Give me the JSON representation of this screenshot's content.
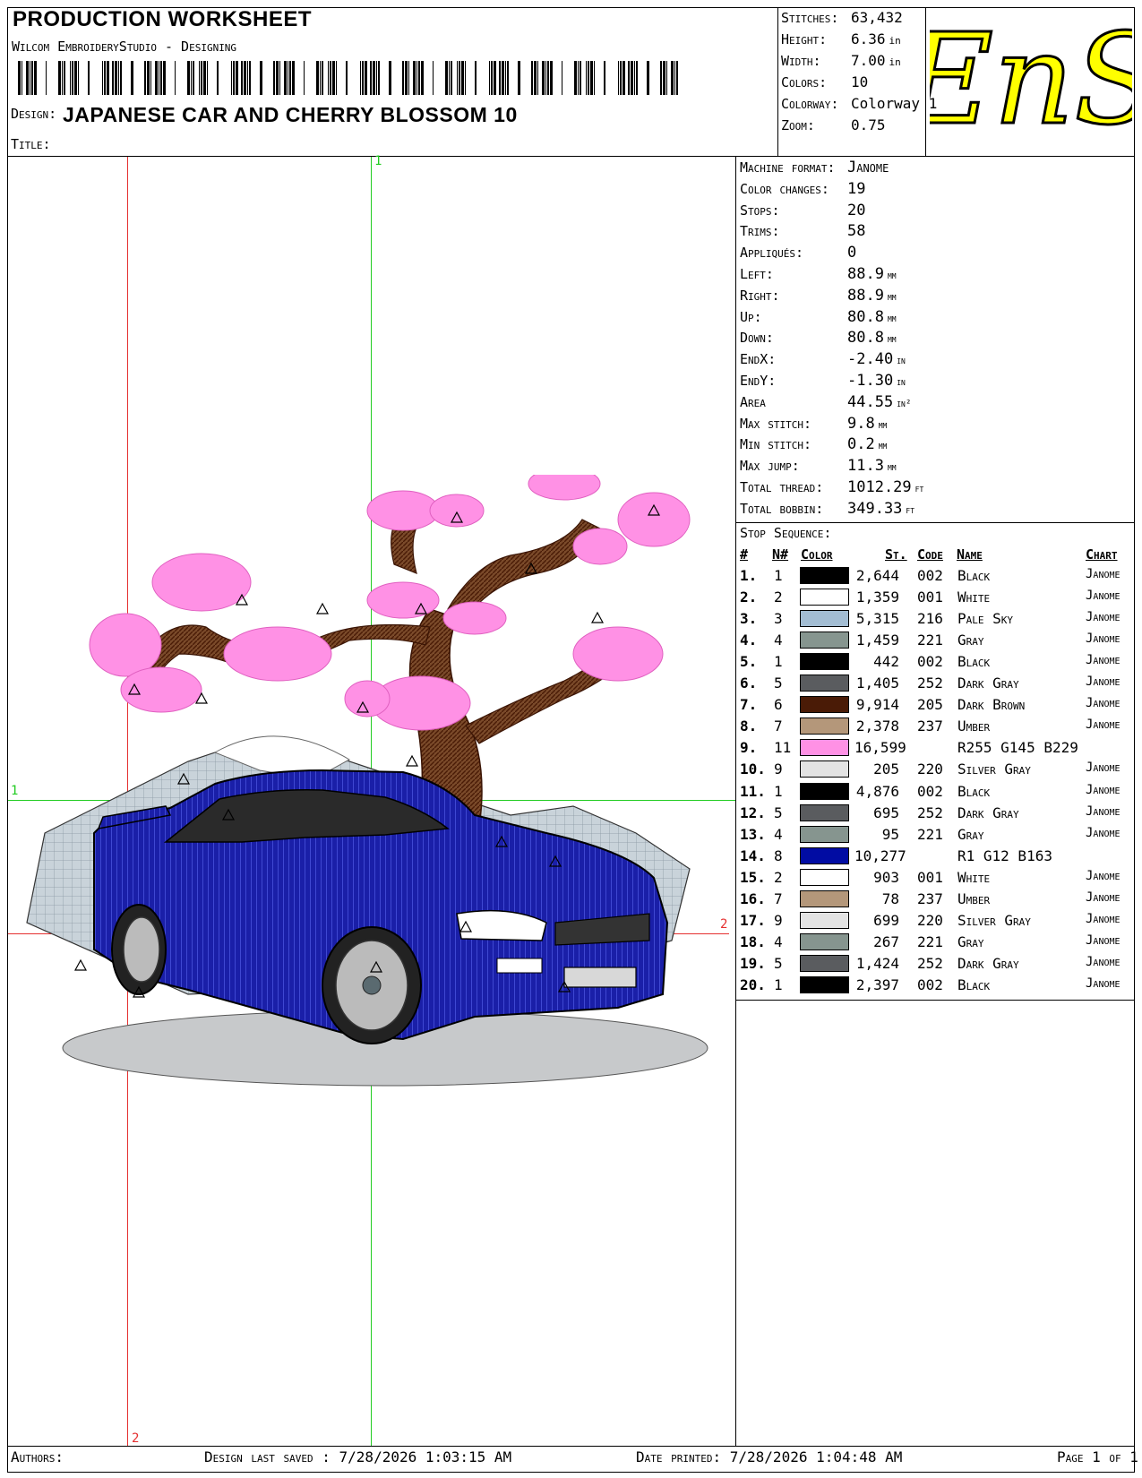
{
  "header": {
    "title": "PRODUCTION WORKSHEET",
    "subtitle": "Wilcom EmbroideryStudio - Designing",
    "design_label": "Design:",
    "design_name": "JAPANESE CAR AND CHERRY BLOSSOM  10",
    "title_label": "Title:"
  },
  "stats": [
    {
      "label": "Stitches:",
      "value": "63,432",
      "unit": ""
    },
    {
      "label": "Height:",
      "value": "6.36",
      "unit": "in"
    },
    {
      "label": "Width:",
      "value": "7.00",
      "unit": "in"
    },
    {
      "label": "Colors:",
      "value": "10",
      "unit": ""
    },
    {
      "label": "Colorway:",
      "value": "Colorway 1",
      "unit": ""
    },
    {
      "label": "Zoom:",
      "value": "0.75",
      "unit": ""
    }
  ],
  "logo": {
    "text": "EnS",
    "color": "#ffff00"
  },
  "info": [
    {
      "label": "Machine format:",
      "value": "Janome",
      "unit": ""
    },
    {
      "label": "Color changes:",
      "value": "19",
      "unit": ""
    },
    {
      "label": "Stops:",
      "value": "20",
      "unit": ""
    },
    {
      "label": "Trims:",
      "value": "58",
      "unit": ""
    },
    {
      "label": "Appliqués:",
      "value": "0",
      "unit": ""
    },
    {
      "label": "Left:",
      "value": "88.9",
      "unit": "mm"
    },
    {
      "label": "Right:",
      "value": "88.9",
      "unit": "mm"
    },
    {
      "label": "Up:",
      "value": "80.8",
      "unit": "mm"
    },
    {
      "label": "Down:",
      "value": "80.8",
      "unit": "mm"
    },
    {
      "label": "EndX:",
      "value": "-2.40",
      "unit": "in"
    },
    {
      "label": "EndY:",
      "value": "-1.30",
      "unit": "in"
    },
    {
      "label": "Area",
      "value": "44.55",
      "unit": "in²"
    },
    {
      "label": "Max stitch:",
      "value": "9.8",
      "unit": "mm"
    },
    {
      "label": "Min stitch:",
      "value": "0.2",
      "unit": "mm"
    },
    {
      "label": "Max jump:",
      "value": "11.3",
      "unit": "mm"
    },
    {
      "label": "Total thread:",
      "value": "1012.29",
      "unit": "ft"
    },
    {
      "label": "Total bobbin:",
      "value": "349.33",
      "unit": "ft"
    }
  ],
  "sequence": {
    "title": "Stop Sequence:",
    "headers": {
      "idx": "#",
      "n": "N#",
      "color": "Color",
      "st": "St.",
      "code": "Code",
      "name": "Name",
      "chart": "Chart"
    },
    "rows": [
      {
        "idx": "1.",
        "n": "1",
        "color": "#000000",
        "st": "2,644",
        "code": "002",
        "name": "Black",
        "chart": "Janome"
      },
      {
        "idx": "2.",
        "n": "2",
        "color": "#ffffff",
        "st": "1,359",
        "code": "001",
        "name": "White",
        "chart": "Janome"
      },
      {
        "idx": "3.",
        "n": "3",
        "color": "#a3bdd3",
        "st": "5,315",
        "code": "216",
        "name": "Pale Sky",
        "chart": "Janome"
      },
      {
        "idx": "4.",
        "n": "4",
        "color": "#86958f",
        "st": "1,459",
        "code": "221",
        "name": "Gray",
        "chart": "Janome"
      },
      {
        "idx": "5.",
        "n": "1",
        "color": "#000000",
        "st": "442",
        "code": "002",
        "name": "Black",
        "chart": "Janome"
      },
      {
        "idx": "6.",
        "n": "5",
        "color": "#5a5c5f",
        "st": "1,405",
        "code": "252",
        "name": "Dark Gray",
        "chart": "Janome"
      },
      {
        "idx": "7.",
        "n": "6",
        "color": "#4a1b06",
        "st": "9,914",
        "code": "205",
        "name": "Dark Brown",
        "chart": "Janome"
      },
      {
        "idx": "8.",
        "n": "7",
        "color": "#b4977a",
        "st": "2,378",
        "code": "237",
        "name": "Umber",
        "chart": "Janome"
      },
      {
        "idx": "9.",
        "n": "11",
        "color": "#ff91e5",
        "st": "16,599",
        "code": "",
        "name": "R255 G145 B229",
        "chart": ""
      },
      {
        "idx": "10.",
        "n": "9",
        "color": "#e3e3e3",
        "st": "205",
        "code": "220",
        "name": "Silver Gray",
        "chart": "Janome"
      },
      {
        "idx": "11.",
        "n": "1",
        "color": "#000000",
        "st": "4,876",
        "code": "002",
        "name": "Black",
        "chart": "Janome"
      },
      {
        "idx": "12.",
        "n": "5",
        "color": "#5a5c5f",
        "st": "695",
        "code": "252",
        "name": "Dark Gray",
        "chart": "Janome"
      },
      {
        "idx": "13.",
        "n": "4",
        "color": "#86958f",
        "st": "95",
        "code": "221",
        "name": "Gray",
        "chart": "Janome"
      },
      {
        "idx": "14.",
        "n": "8",
        "color": "#010ca3",
        "st": "10,277",
        "code": "",
        "name": "R1 G12 B163",
        "chart": ""
      },
      {
        "idx": "15.",
        "n": "2",
        "color": "#ffffff",
        "st": "903",
        "code": "001",
        "name": "White",
        "chart": "Janome"
      },
      {
        "idx": "16.",
        "n": "7",
        "color": "#b4977a",
        "st": "78",
        "code": "237",
        "name": "Umber",
        "chart": "Janome"
      },
      {
        "idx": "17.",
        "n": "9",
        "color": "#e3e3e3",
        "st": "699",
        "code": "220",
        "name": "Silver Gray",
        "chart": "Janome"
      },
      {
        "idx": "18.",
        "n": "4",
        "color": "#86958f",
        "st": "267",
        "code": "221",
        "name": "Gray",
        "chart": "Janome"
      },
      {
        "idx": "19.",
        "n": "5",
        "color": "#5a5c5f",
        "st": "1,424",
        "code": "252",
        "name": "Dark Gray",
        "chart": "Janome"
      },
      {
        "idx": "20.",
        "n": "1",
        "color": "#000000",
        "st": "2,397",
        "code": "002",
        "name": "Black",
        "chart": "Janome"
      }
    ]
  },
  "guides": {
    "v1": "1",
    "v2": "2",
    "h1": "1",
    "h2": "2"
  },
  "footer": {
    "authors_label": "Authors:",
    "saved_label": "Design last saved :",
    "saved_value": "7/28/2026 1:03:15 AM",
    "printed_label": "Date printed:",
    "printed_value": "7/28/2026 1:04:48 AM",
    "page": "Page 1 of 1"
  }
}
